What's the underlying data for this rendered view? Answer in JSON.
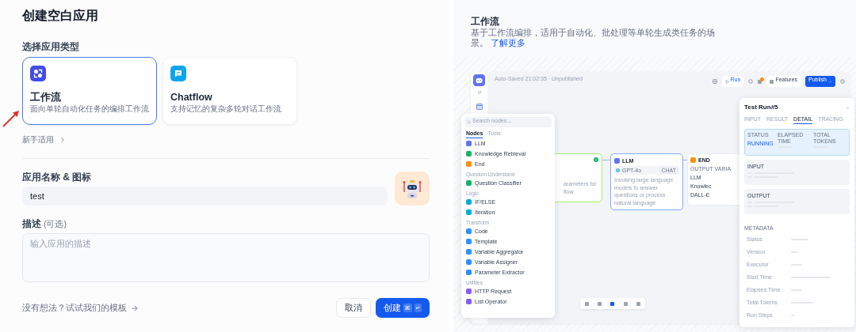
{
  "dialog": {
    "title": "创建空白应用"
  },
  "app_type": {
    "label": "选择应用类型",
    "options": [
      {
        "kind": "workflow",
        "title": "工作流",
        "description": "面向单轮自动化任务的编排工作流",
        "selected": true
      },
      {
        "kind": "chatflow",
        "title": "Chatflow",
        "description": "支持记忆的复杂多轮对话工作流",
        "selected": false
      }
    ],
    "beginner_link": "新手适用"
  },
  "name_field": {
    "label": "应用名称 & 图标",
    "value": "test"
  },
  "description_field": {
    "label": "描述",
    "optional": "(可选)",
    "placeholder": "输入应用的描述"
  },
  "template_link": "没有想法？试试我们的模板",
  "buttons": {
    "cancel": "取消",
    "create": "创建",
    "shortcut_keys": [
      "⌘",
      "↵"
    ]
  },
  "preview": {
    "title": "工作流",
    "description": "基于工作流编排，适用于自动化、批处理等单轮生成类任务的场景。",
    "learn_more": "了解更多",
    "app": {
      "save_status": "Auto-Saved 21:02:35 · Unpublished",
      "run": "Run",
      "features": "Features",
      "publish": "Publish",
      "node_picker": {
        "placeholder": "Search nodes...",
        "tabs": [
          {
            "label": "Nodes",
            "selected": true
          },
          {
            "label": "Tools",
            "selected": false
          }
        ],
        "groups": [
          {
            "items": [
              {
                "label": "LLM",
                "color": "#6172f3"
              },
              {
                "label": "Knowledge Retrieval",
                "color": "#16b364"
              },
              {
                "label": "End",
                "color": "#f79009"
              }
            ]
          },
          {
            "title": "Question Understand",
            "items": [
              {
                "label": "Question Classifier",
                "color": "#16b364"
              }
            ]
          },
          {
            "title": "Logic",
            "items": [
              {
                "label": "IF/ELSE",
                "color": "#06aed4"
              },
              {
                "label": "Iteration",
                "color": "#06aed4"
              }
            ]
          },
          {
            "title": "Transform",
            "items": [
              {
                "label": "Code",
                "color": "#2e90fa"
              },
              {
                "label": "Template",
                "color": "#2e90fa"
              },
              {
                "label": "Variable Aggregator",
                "color": "#2e90fa"
              },
              {
                "label": "Variable Assigner",
                "color": "#2e90fa"
              },
              {
                "label": "Parameter Extractor",
                "color": "#2e90fa"
              }
            ]
          },
          {
            "title": "Utilities",
            "items": [
              {
                "label": "HTTP Request",
                "color": "#875bf7"
              },
              {
                "label": "List Operator",
                "color": "#875bf7"
              }
            ]
          }
        ]
      },
      "start_node": {
        "description_lines": [
          "arameters for",
          "flow"
        ]
      },
      "llm_node": {
        "title": "LLM",
        "model": "GPT-4o",
        "mode": "CHAT",
        "description": "Invoking large language models to answer questions or process natural language"
      },
      "end_node": {
        "title": "END",
        "output_label": "OUTPUT VARIA",
        "outputs": [
          "LLM",
          "Knowlec",
          "DALL-E"
        ]
      },
      "test_run": {
        "title": "Test Run#5",
        "tabs": [
          {
            "label": "INPUT",
            "selected": false
          },
          {
            "label": "RESULT",
            "selected": false
          },
          {
            "label": "DETAIL",
            "selected": true
          },
          {
            "label": "TRACING",
            "selected": false
          }
        ],
        "status_label": "STATUS",
        "status_value": "RUNNING",
        "elapsed_label": "ELAPSED TIME",
        "tokens_label": "TOTAL TOKENS",
        "sections": [
          "INPUT",
          "OUTPUT"
        ],
        "metadata_title": "METADATA",
        "metadata": [
          "Status",
          "Version",
          "Executor",
          "Start Time",
          "Elapsed Time",
          "Total Tokens",
          "Run Steps"
        ]
      }
    }
  }
}
